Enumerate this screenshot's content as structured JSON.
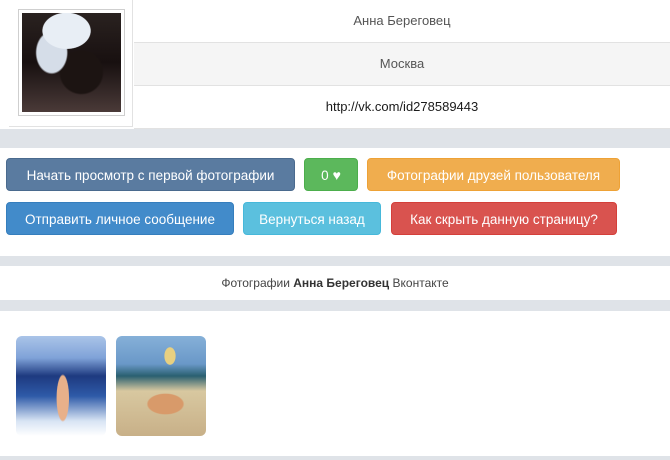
{
  "profile": {
    "name": "Анна Береговец",
    "city": "Москва",
    "url": "http://vk.com/id278589443"
  },
  "buttons": {
    "start_view": "Начать просмотр с первой фотографии",
    "likes_count": "0",
    "friends_photos": "Фотографии друзей пользователя",
    "send_message": "Отправить личное сообщение",
    "go_back": "Вернуться назад",
    "hide_page": "Как скрыть данную страницу?"
  },
  "caption": {
    "prefix": "Фотографии",
    "name": "Анна Береговец",
    "suffix": "Вконтакте"
  },
  "photos_count": 2,
  "icons": {
    "like": "heart-icon"
  },
  "colors": {
    "gray_button": "#5a7ba0",
    "green_button": "#5cb85c",
    "orange_button": "#f0ad4e",
    "blue_button": "#428bca",
    "cyan_button": "#5bc0de",
    "red_button": "#d9534f"
  }
}
